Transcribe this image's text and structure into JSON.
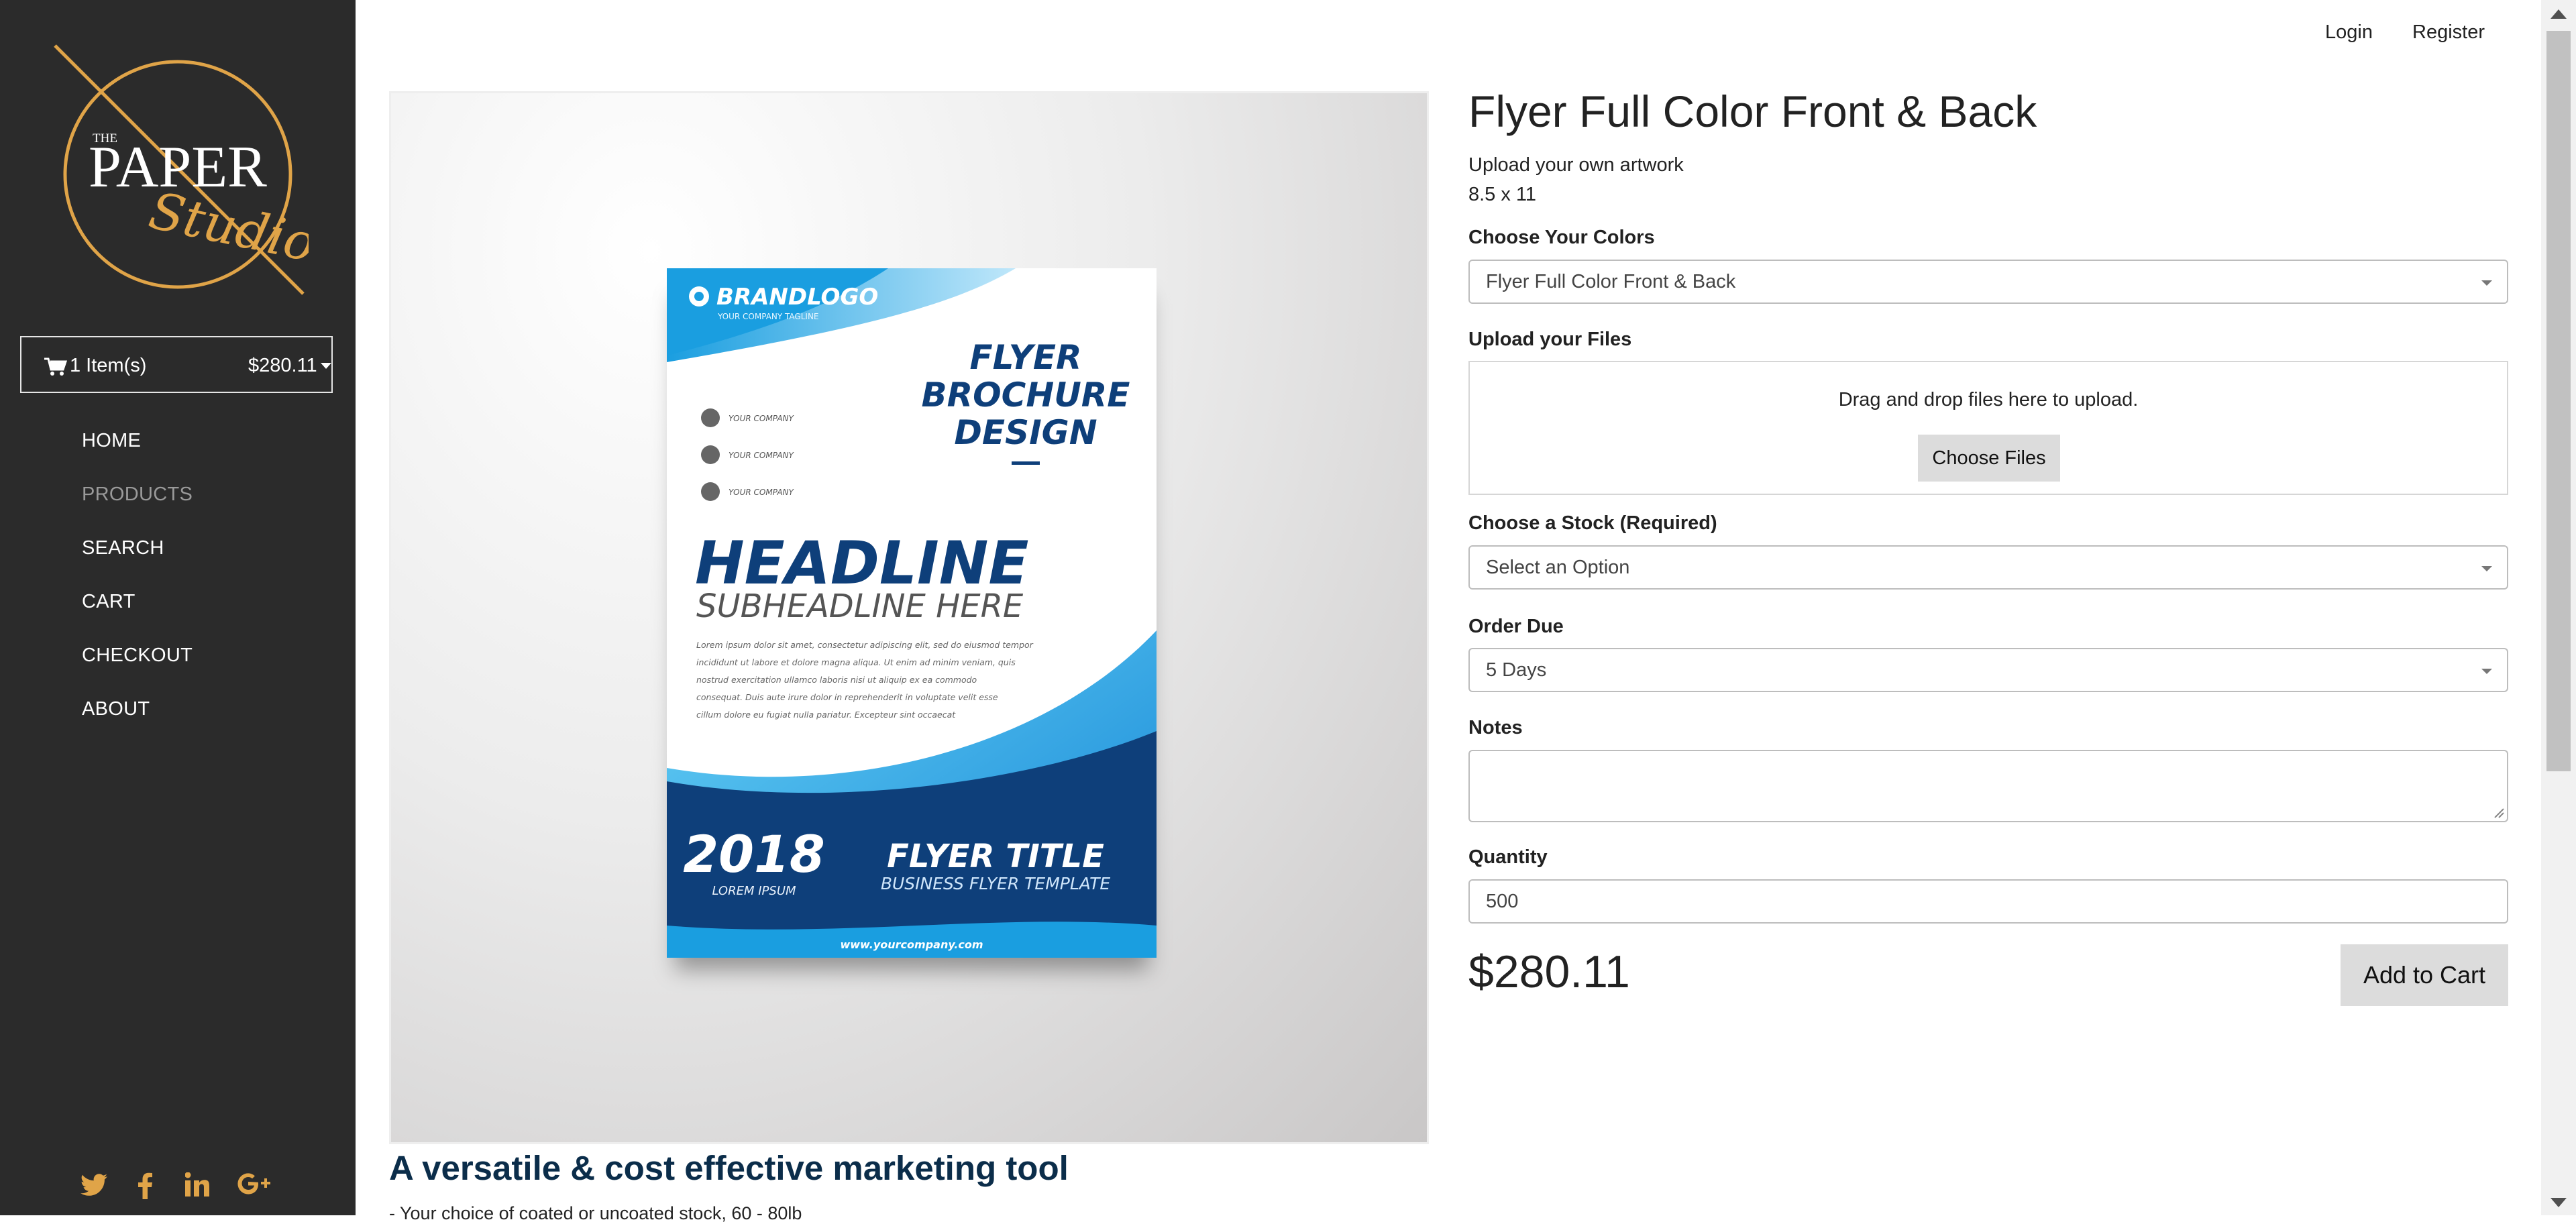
{
  "brand": {
    "logo_small": "THE",
    "logo_main": "PAPER",
    "logo_script": "Studio"
  },
  "cart": {
    "count_label": "1 Item(s)",
    "total": "$280.11"
  },
  "nav": {
    "items": [
      {
        "label": "HOME"
      },
      {
        "label": "PRODUCTS"
      },
      {
        "label": "SEARCH"
      },
      {
        "label": "CART"
      },
      {
        "label": "CHECKOUT"
      },
      {
        "label": "ABOUT"
      }
    ]
  },
  "social_icons": [
    "twitter-icon",
    "facebook-icon",
    "linkedin-icon",
    "google-plus-icon"
  ],
  "topnav": {
    "login": "Login",
    "register": "Register"
  },
  "flyer": {
    "brandlogo": "BRANDLOGO",
    "tagline": "YOUR COMPANY TAGLINE",
    "title_line1": "FLYER",
    "title_line2": "BROCHURE",
    "title_line3": "DESIGN",
    "company_rows": [
      "YOUR COMPANY",
      "YOUR COMPANY",
      "YOUR COMPANY"
    ],
    "headline": "HEADLINE",
    "subheadline": "SUBHEADLINE HERE",
    "body": [
      "Lorem ipsum dolor sit amet, consectetur adipiscing elit, sed do eiusmod tempor",
      "incididunt ut labore et dolore magna aliqua. Ut enim ad minim veniam, quis",
      "nostrud exercitation ullamco laboris nisi ut aliquip ex ea commodo",
      "consequat. Duis aute irure dolor in reprehenderit in voluptate velit esse",
      "cillum dolore eu fugiat nulla pariatur. Excepteur sint occaecat"
    ],
    "year": "2018",
    "year_sub": "LOREM IPSUM",
    "flyer_title": "FLYER TITLE",
    "flyer_title_sub": "BUSINESS FLYER TEMPLATE",
    "url": "www.yourcompany.com"
  },
  "product": {
    "title": "Flyer Full Color Front & Back",
    "subtitle": "Upload your own artwork",
    "size": "8.5 x 11",
    "colors_label": "Choose Your Colors",
    "colors_value": "Flyer Full Color Front & Back",
    "upload_label": "Upload your Files",
    "upload_text": "Drag and drop files here to upload.",
    "choose_files": "Choose Files",
    "stock_label": "Choose a Stock (Required)",
    "stock_value": "Select an Option",
    "due_label": "Order Due",
    "due_value": "5 Days",
    "notes_label": "Notes",
    "notes_value": "",
    "quantity_label": "Quantity",
    "quantity_value": "500",
    "price": "$280.11",
    "add_to_cart": "Add to Cart"
  },
  "description": {
    "heading": "A versatile & cost effective marketing tool",
    "first_line": "- Your choice of coated or uncoated stock, 60 - 80lb"
  },
  "colors": {
    "sidebar_bg": "#2b2b2b",
    "accent_gold": "#e0a448",
    "flyer_blue": "#1a9ee0",
    "flyer_navy": "#0e3f7a"
  }
}
